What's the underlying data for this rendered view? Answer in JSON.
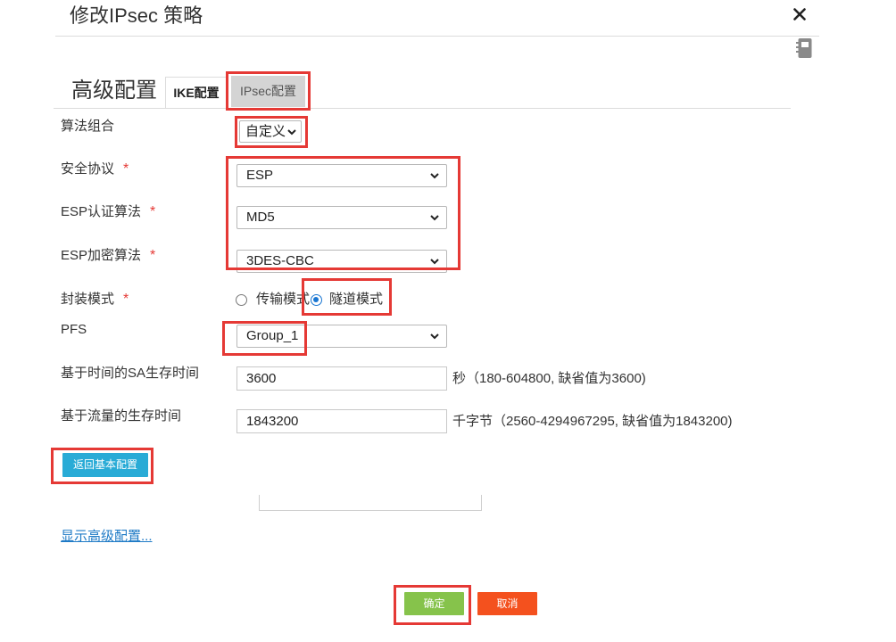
{
  "dialog": {
    "title": "修改IPsec 策略"
  },
  "section": {
    "title": "高级配置",
    "tabs": [
      {
        "label": "IKE配置"
      },
      {
        "label": "IPsec配置"
      }
    ]
  },
  "form": {
    "algorithm_combo": {
      "label": "算法组合",
      "value": "自定义"
    },
    "security_protocol": {
      "label": "安全协议",
      "required": "*",
      "value": "ESP"
    },
    "esp_auth": {
      "label": "ESP认证算法",
      "required": "*",
      "value": "MD5"
    },
    "esp_encrypt": {
      "label": "ESP加密算法",
      "required": "*",
      "value": "3DES-CBC"
    },
    "encap_mode": {
      "label": "封装模式",
      "required": "*",
      "options": [
        {
          "label": "传输模式",
          "checked": false
        },
        {
          "label": "隧道模式",
          "checked": true
        }
      ]
    },
    "pfs": {
      "label": "PFS",
      "value": "Group_1"
    },
    "sa_time": {
      "label": "基于时间的SA生存时间",
      "value": "3600",
      "hint": "秒（180-604800, 缺省值为3600)"
    },
    "sa_traffic": {
      "label": "基于流量的生存时间",
      "value": "1843200",
      "hint": "千字节（2560-4294967295, 缺省值为1843200)"
    }
  },
  "back_button": {
    "label": "返回基本配置"
  },
  "advanced_link": {
    "label": "显示高级配置..."
  },
  "footer": {
    "ok_label": "确定",
    "cancel_label": "取消"
  },
  "icons": {
    "close": "close-icon",
    "notebook": "notebook-icon",
    "select_arrow": "chevron-down-icon",
    "radio": "radio-icon"
  },
  "colors": {
    "accent_blue": "#1976d2",
    "link": "#1e7ac6",
    "back_button": "#29abd6",
    "ok_button": "#86c34b",
    "cancel_button": "#f4511e",
    "required": "#e53935",
    "annotation_red": "#e53935"
  }
}
